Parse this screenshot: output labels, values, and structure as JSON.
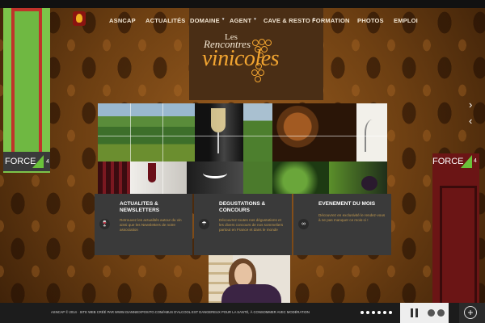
{
  "nav": {
    "items": [
      {
        "label": "ASNCAP",
        "dropdown": false
      },
      {
        "label": "ACTUALITÉS",
        "dropdown": false
      },
      {
        "label": "DOMAINE",
        "dropdown": true
      },
      {
        "label": "AGENT",
        "dropdown": true
      },
      {
        "label": "CAVE & RESTO",
        "dropdown": true
      },
      {
        "label": "FORMATION",
        "dropdown": false
      },
      {
        "label": "PHOTOS",
        "dropdown": false
      },
      {
        "label": "EMPLOI",
        "dropdown": false
      }
    ]
  },
  "hero": {
    "line1_small": "Les",
    "line1": "Rencontres",
    "line2": "vinicoles"
  },
  "banners": {
    "left": {
      "text": "FORCE",
      "num": "4"
    },
    "right": {
      "text": "FORCE",
      "num": "4"
    }
  },
  "cards": [
    {
      "title": "ACTUALITES &\nNEWSLETTERS",
      "text": "Retrouvez les actualités autour du vin ainsi que les Newsletters de notre association",
      "icon": "wine-glass-icon"
    },
    {
      "title": "DEGUSTATIONS &\nCONCOURS",
      "text": "Découvrez toutes nos dégustations et les divers concours de nos sommeliers partout en France et dans le monde",
      "icon": "umbrella-icon"
    },
    {
      "title": "EVENEMENT DU MOIS",
      "text": "Découvrez en exclusivité le rendez-vous à ne pas manquer ce mois-ci !",
      "icon": "link-icon"
    }
  ],
  "footer": {
    "text": "ASNCAP © 2014 · SITE WEB CRÉÉ PAR WWW.GIANNIEXPOSITO.COM/ABUS D'ALCOOL EST DANGEREUX POUR LA SANTÉ, À CONSOMMER AVEC MODÉRATION",
    "dots": 6
  },
  "colors": {
    "accent": "#f2a531",
    "card_bg": "#3a3a3a",
    "green": "#7cc44a"
  }
}
